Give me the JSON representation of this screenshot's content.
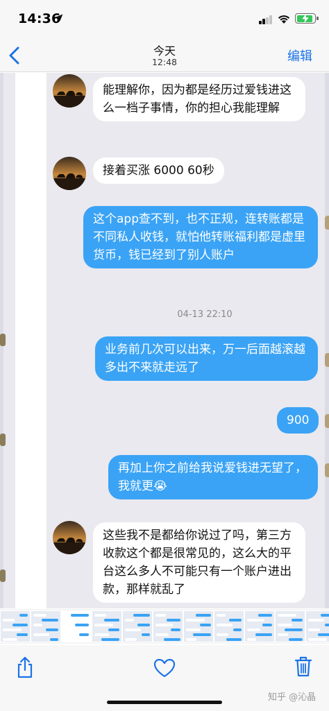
{
  "status_bar": {
    "time": "14:36",
    "battery_level": 0.9
  },
  "nav": {
    "title": "今天",
    "subtitle": "12:48",
    "edit_label": "编辑"
  },
  "chat": {
    "messages": [
      {
        "side": "in",
        "text": "能理解你，因为都是经历过爱钱进这么一档子事情，你的担心我能理解"
      },
      {
        "side": "in",
        "text": "接着买涨 6000 60秒"
      },
      {
        "side": "out",
        "text": "这个app查不到，也不正规，连转账都是不同私人收钱，就怕他转账福利都是虚里货币，钱已经到了别人账户"
      },
      {
        "side": "out",
        "text": "业务前几次可以出来，万一后面越滚越多出不来就走远了"
      },
      {
        "side": "out",
        "text": "900"
      },
      {
        "side": "out",
        "text": "再加上你之前给我说爱钱进无望了，我就更😭"
      },
      {
        "side": "in",
        "text": "这些我不是都给你说过了吗，第三方收款这个都是很常见的，这么大的平台这么多人不可能只有一个账户进出款，那样就乱了"
      }
    ],
    "timestamp": "04-13 22:10"
  },
  "toolbar": {
    "share": "share-icon",
    "favorite": "heart-icon",
    "delete": "trash-icon"
  },
  "watermark": "知乎 @沁晶",
  "colors": {
    "accent": "#1a73e8",
    "outgoing_bubble": "#3aa3f5",
    "incoming_bubble": "#ffffff",
    "chat_background": "#e9e9ef",
    "battery": "#34c759"
  }
}
